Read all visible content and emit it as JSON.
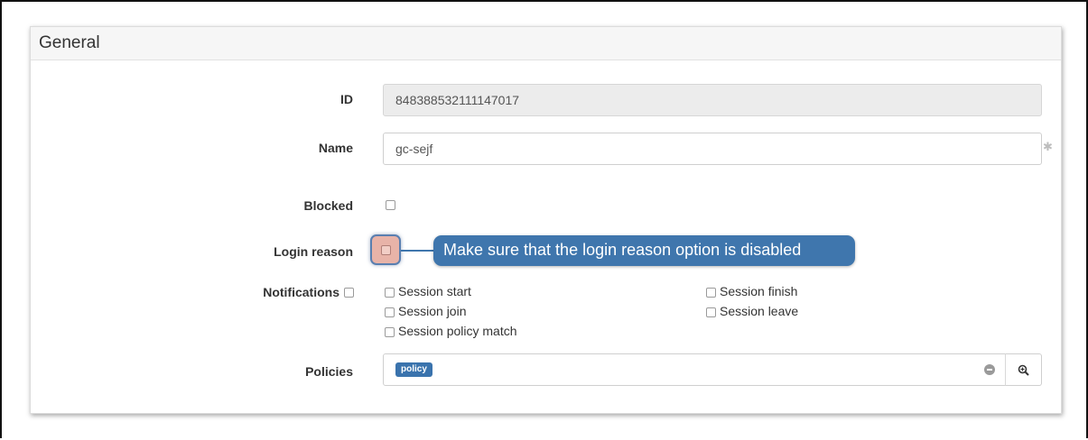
{
  "panel": {
    "title": "General"
  },
  "fields": {
    "id": {
      "label": "ID",
      "value": "848388532111147017"
    },
    "name": {
      "label": "Name",
      "value": "gc-sejf"
    },
    "blocked": {
      "label": "Blocked",
      "checked": false
    },
    "login_reason": {
      "label": "Login reason",
      "checked": false
    },
    "notifications": {
      "label": "Notifications",
      "checked": false,
      "options": [
        {
          "label": "Session start",
          "checked": false
        },
        {
          "label": "Session join",
          "checked": false
        },
        {
          "label": "Session policy match",
          "checked": false
        },
        {
          "label": "Session finish",
          "checked": false
        },
        {
          "label": "Session leave",
          "checked": false
        }
      ]
    },
    "policies": {
      "label": "Policies",
      "tags": [
        "policy"
      ]
    }
  },
  "callout": {
    "text": "Make sure that the login reason option is disabled"
  },
  "colors": {
    "callout_bg": "#3f76ad",
    "highlight_bg": "#e8b3a8",
    "tag_bg": "#3a73ad"
  },
  "icons": {
    "required": "asterisk-icon",
    "clear": "clear-circle-icon",
    "search": "zoom-in-icon"
  }
}
